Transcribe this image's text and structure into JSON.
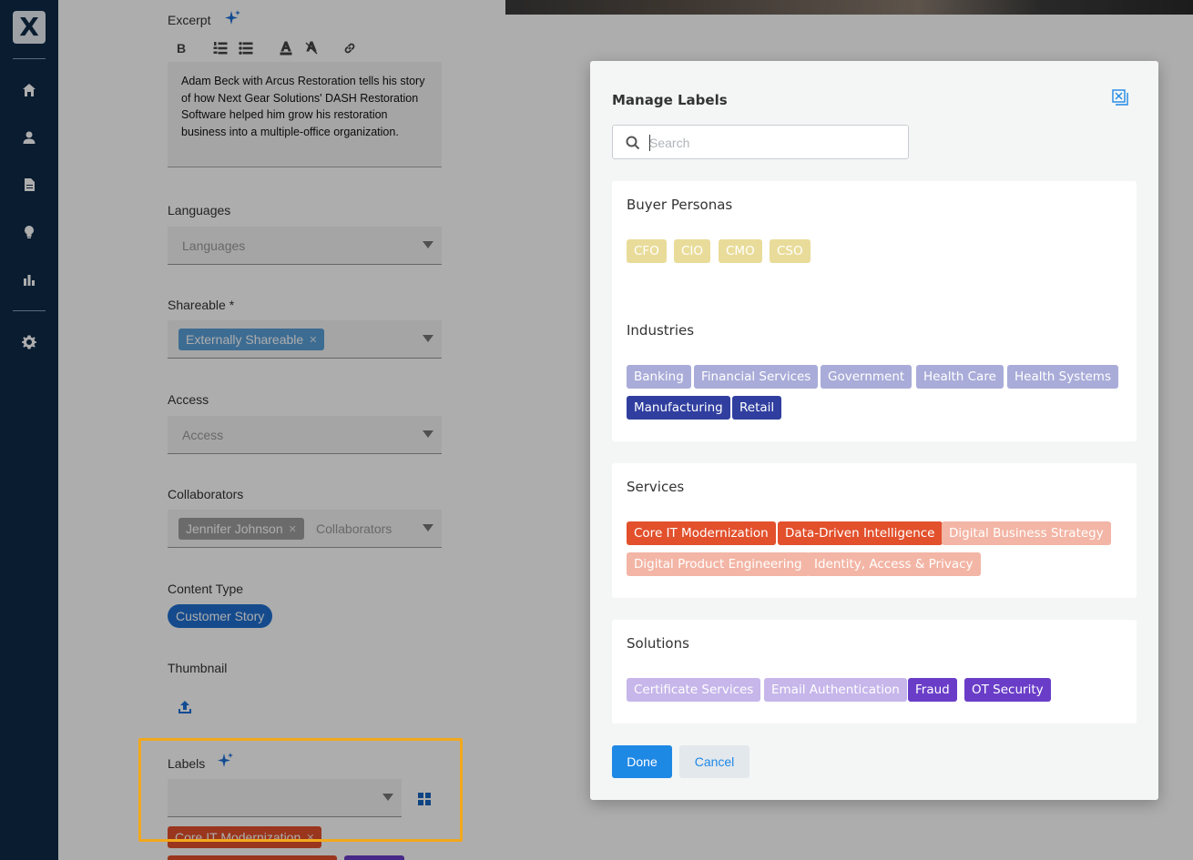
{
  "sidebar": {
    "logo_text": "X",
    "items": [
      {
        "icon": "home-icon"
      },
      {
        "icon": "user-icon"
      },
      {
        "icon": "document-icon"
      },
      {
        "icon": "lightbulb-icon"
      },
      {
        "icon": "bar-chart-icon"
      },
      {
        "icon": "gear-icon"
      }
    ]
  },
  "form": {
    "excerpt": {
      "label": "Excerpt",
      "text": "Adam Beck with Arcus Restoration tells his story of how Next Gear Solutions' DASH Restoration Software helped him grow his restoration business into a multiple-office organization."
    },
    "toolbar": {
      "bold": "B",
      "ordered_list": "ordered-list-icon",
      "bullet_list": "bullet-list-icon",
      "text_color": "text-color-icon",
      "clear_format": "clear-format-icon",
      "link": "link-icon"
    },
    "languages": {
      "label": "Languages",
      "placeholder": "Languages"
    },
    "shareable": {
      "label": "Shareable *",
      "chip": "Externally Shareable",
      "chip_color": "#5aa0d8"
    },
    "access": {
      "label": "Access",
      "placeholder": "Access"
    },
    "collaborators": {
      "label": "Collaborators",
      "chip": "Jennifer Johnson",
      "placeholder": "Collaborators"
    },
    "content_type": {
      "label": "Content Type",
      "value": "Customer Story"
    },
    "thumbnail": {
      "label": "Thumbnail"
    },
    "labels": {
      "label": "Labels",
      "chip": "Core IT Modernization"
    }
  },
  "modal": {
    "title": "Manage Labels",
    "search_placeholder": "Search",
    "groups": [
      {
        "name": "Buyer Personas",
        "tags": [
          {
            "label": "CFO",
            "selected": false
          },
          {
            "label": "CIO",
            "selected": false
          },
          {
            "label": "CMO",
            "selected": false
          },
          {
            "label": "CSO",
            "selected": false
          }
        ],
        "color_on": "#d4b21a",
        "color_off": "#e9dc9a"
      },
      {
        "name": "Industries",
        "tags": [
          {
            "label": "Banking",
            "selected": false
          },
          {
            "label": "Financial Services",
            "selected": false
          },
          {
            "label": "Government",
            "selected": false
          },
          {
            "label": "Health Care",
            "selected": false
          },
          {
            "label": "Health Systems",
            "selected": false
          },
          {
            "label": "Manufacturing",
            "selected": true
          },
          {
            "label": "Retail",
            "selected": true
          }
        ],
        "color_on": "#303f9f",
        "color_off": "#a9acd8"
      },
      {
        "name": "Services",
        "tags": [
          {
            "label": "Core IT Modernization",
            "selected": true
          },
          {
            "label": "Data-Driven Intelligence",
            "selected": true
          },
          {
            "label": "Digital Business Strategy",
            "selected": false
          },
          {
            "label": "Digital Product Engineering",
            "selected": false
          },
          {
            "label": "Identity, Access & Privacy",
            "selected": false
          }
        ],
        "color_on": "#e2502c",
        "color_off": "#f3b5a5"
      },
      {
        "name": "Solutions",
        "tags": [
          {
            "label": "Certificate Services",
            "selected": false
          },
          {
            "label": "Email Authentication",
            "selected": false
          },
          {
            "label": "Fraud",
            "selected": true
          },
          {
            "label": "OT Security",
            "selected": true
          }
        ],
        "color_on": "#6a3dc8",
        "color_off": "#c6b6ea"
      }
    ],
    "done_label": "Done",
    "cancel_label": "Cancel"
  }
}
